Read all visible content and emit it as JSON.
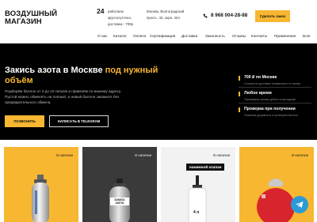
{
  "header": {
    "logo": "ВОЗДУШНЫЙ МАГАЗИН",
    "hours_number": "24",
    "hours_text": "работаем круглосуточно, доставка - 700р",
    "address": "Москва, Волгоградский просп., 42, корп. 42А",
    "phone": "8 968 004-28-88",
    "order_button": "Сделать заказ"
  },
  "nav": {
    "items": [
      "О нас",
      "Каталог",
      "Оплата",
      "Сертификация",
      "Доставка",
      "Законность",
      "Отзывы",
      "Контакты",
      "Применение",
      "Блог"
    ]
  },
  "hero": {
    "title_plain": "Закись азота в Москве ",
    "title_accent": "под нужный объём",
    "description": "Подберём баллон от 2 до 10 литров и привезём по вашему адресу. Пустой можно обменять на полный, а новый баллон закажите без предварительного обмена.",
    "call_button": "ПОЗВОНИТЬ",
    "telegram_button": "НАПИСАТЬ В TELEGRAM",
    "features": [
      {
        "title": "700 ₽ по Москве",
        "subtitle": "Стоимость доставки независимо от заказа"
      },
      {
        "title": "Любое время",
        "subtitle": "Принимаем заказы днём и в выходные"
      },
      {
        "title": "Проверка при получении",
        "subtitle": "Покажем документы и проверим баллон"
      }
    ]
  },
  "products": {
    "cards": [
      {
        "badge": "В наличии",
        "bg": "#f7b731"
      },
      {
        "badge": "В наличии",
        "bg": "#3a3a3a",
        "label": "ЗАКИСЬ АЗОТА"
      },
      {
        "badge": "В наличии",
        "bg": "#f2f2f2",
        "label": "нажимной клапан",
        "volume": "4 л"
      },
      {
        "badge": "В наличии",
        "bg": "#f7b731"
      }
    ]
  },
  "colors": {
    "accent": "#f7b731",
    "hero_bg": "#000000",
    "telegram": "#2a9bd7"
  },
  "icons": [
    "phone-icon",
    "telegram-icon"
  ]
}
